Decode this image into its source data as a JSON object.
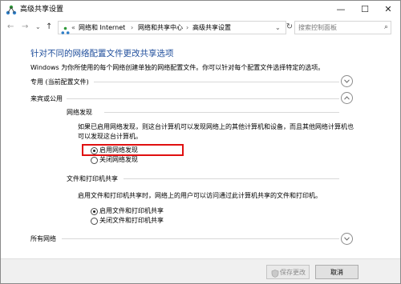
{
  "window": {
    "title": "高级共享设置",
    "minimize_glyph": "—",
    "maximize_glyph": "☐",
    "close_glyph": "✕"
  },
  "nav": {
    "back_glyph": "←",
    "forward_glyph": "→",
    "dropdown_glyph": "⌄",
    "up_glyph": "↑",
    "refresh_glyph": "↻"
  },
  "breadcrumb": {
    "overflow": "«",
    "sep": "›",
    "items": [
      "网络和 Internet",
      "网络和共享中心",
      "高级共享设置"
    ],
    "dropdown_glyph": "⌄"
  },
  "search": {
    "placeholder": "搜索控制面板",
    "icon_glyph": "⌕"
  },
  "main": {
    "heading": "针对不同的网络配置文件更改共享选项",
    "description": "Windows 为你所使用的每个网络创建单独的网络配置文件。你可以针对每个配置文件选择特定的选项。",
    "profiles": [
      {
        "label": "专用 (当前配置文件)",
        "expanded": false
      },
      {
        "label": "来宾或公用",
        "expanded": true
      },
      {
        "label": "所有网络",
        "expanded": false
      }
    ],
    "network_discovery": {
      "title": "网络发现",
      "description_line1": "如果已启用网络发现，则这台计算机可以发现网络上的其他计算机和设备，而且其他网络计算机也",
      "description_line2": "可以发现这台计算机。",
      "options": [
        {
          "label": "启用网络发现",
          "selected": true
        },
        {
          "label": "关闭网络发现",
          "selected": false
        }
      ]
    },
    "file_printer_sharing": {
      "title": "文件和打印机共享",
      "description": "启用文件和打印机共享时，网络上的用户可以访问通过此计算机共享的文件和打印机。",
      "options": [
        {
          "label": "启用文件和打印机共享",
          "selected": true
        },
        {
          "label": "关闭文件和打印机共享",
          "selected": false
        }
      ]
    }
  },
  "footer": {
    "save_label": "保存更改",
    "save_enabled": false,
    "cancel_label": "取消"
  },
  "colors": {
    "heading": "#1e4d9b",
    "highlight": "#e01010",
    "footer_bg": "#f0f0f0"
  }
}
